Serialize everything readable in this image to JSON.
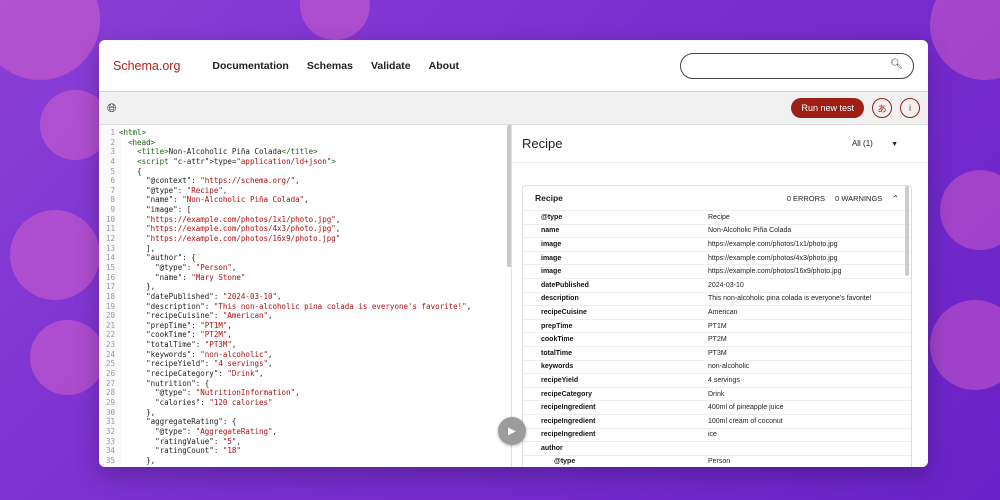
{
  "nav": {
    "brand": "Schema.org",
    "links": [
      "Documentation",
      "Schemas",
      "Validate",
      "About"
    ],
    "search_placeholder": ""
  },
  "toolbar": {
    "run_label": "Run new test",
    "translate_icon": "translate-icon",
    "info_icon": "info-icon",
    "globe_icon": "globe-icon"
  },
  "code_lines": [
    {
      "n": "1",
      "t": "<html>"
    },
    {
      "n": "2",
      "t": "  <head>"
    },
    {
      "n": "3",
      "t": "    <title>Non-Alcoholic Piña Colada</title>"
    },
    {
      "n": "4",
      "t": "    <script type=\"application/ld+json\">"
    },
    {
      "n": "5",
      "t": "    {"
    },
    {
      "n": "6",
      "t": "      \"@context\": \"https://schema.org/\","
    },
    {
      "n": "7",
      "t": "      \"@type\": \"Recipe\","
    },
    {
      "n": "8",
      "t": "      \"name\": \"Non-Alcoholic Piña Colada\","
    },
    {
      "n": "9",
      "t": "      \"image\": ["
    },
    {
      "n": "10",
      "t": "      \"https://example.com/photos/1x1/photo.jpg\","
    },
    {
      "n": "11",
      "t": "      \"https://example.com/photos/4x3/photo.jpg\","
    },
    {
      "n": "12",
      "t": "      \"https://example.com/photos/16x9/photo.jpg\""
    },
    {
      "n": "13",
      "t": "      ],"
    },
    {
      "n": "14",
      "t": "      \"author\": {"
    },
    {
      "n": "15",
      "t": "        \"@type\": \"Person\","
    },
    {
      "n": "16",
      "t": "        \"name\": \"Mary Stone\""
    },
    {
      "n": "17",
      "t": "      },"
    },
    {
      "n": "18",
      "t": "      \"datePublished\": \"2024-03-10\","
    },
    {
      "n": "19",
      "t": "      \"description\": \"This non-alcoholic pina colada is everyone's favorite!\","
    },
    {
      "n": "20",
      "t": "      \"recipeCuisine\": \"American\","
    },
    {
      "n": "21",
      "t": "      \"prepTime\": \"PT1M\","
    },
    {
      "n": "22",
      "t": "      \"cookTime\": \"PT2M\","
    },
    {
      "n": "23",
      "t": "      \"totalTime\": \"PT3M\","
    },
    {
      "n": "24",
      "t": "      \"keywords\": \"non-alcoholic\","
    },
    {
      "n": "25",
      "t": "      \"recipeYield\": \"4 servings\","
    },
    {
      "n": "26",
      "t": "      \"recipeCategory\": \"Drink\","
    },
    {
      "n": "27",
      "t": "      \"nutrition\": {"
    },
    {
      "n": "28",
      "t": "        \"@type\": \"NutritionInformation\","
    },
    {
      "n": "29",
      "t": "        \"calories\": \"120 calories\""
    },
    {
      "n": "30",
      "t": "      },"
    },
    {
      "n": "31",
      "t": "      \"aggregateRating\": {"
    },
    {
      "n": "32",
      "t": "        \"@type\": \"AggregateRating\","
    },
    {
      "n": "33",
      "t": "        \"ratingValue\": \"5\","
    },
    {
      "n": "34",
      "t": "        \"ratingCount\": \"18\""
    },
    {
      "n": "35",
      "t": "      },"
    }
  ],
  "results": {
    "title": "Recipe",
    "filter": "All (1)",
    "card_title": "Recipe",
    "errors": "0 ERRORS",
    "warnings": "0 WARNINGS",
    "rows": [
      {
        "k": "@type",
        "v": "Recipe",
        "sub": false
      },
      {
        "k": "name",
        "v": "Non-Alcoholic Piña Colada",
        "sub": false
      },
      {
        "k": "image",
        "v": "https://example.com/photos/1x1/photo.jpg",
        "sub": false
      },
      {
        "k": "image",
        "v": "https://example.com/photos/4x3/photo.jpg",
        "sub": false
      },
      {
        "k": "image",
        "v": "https://example.com/photos/16x9/photo.jpg",
        "sub": false
      },
      {
        "k": "datePublished",
        "v": "2024-03-10",
        "sub": false
      },
      {
        "k": "description",
        "v": "This non-alcoholic pina colada is everyone's favorite!",
        "sub": false
      },
      {
        "k": "recipeCuisine",
        "v": "American",
        "sub": false
      },
      {
        "k": "prepTime",
        "v": "PT1M",
        "sub": false
      },
      {
        "k": "cookTime",
        "v": "PT2M",
        "sub": false
      },
      {
        "k": "totalTime",
        "v": "PT3M",
        "sub": false
      },
      {
        "k": "keywords",
        "v": "non-alcoholic",
        "sub": false
      },
      {
        "k": "recipeYield",
        "v": "4 servings",
        "sub": false
      },
      {
        "k": "recipeCategory",
        "v": "Drink",
        "sub": false
      },
      {
        "k": "recipeIngredient",
        "v": "400ml of pineapple juice",
        "sub": false
      },
      {
        "k": "recipeIngredient",
        "v": "100ml cream of coconut",
        "sub": false
      },
      {
        "k": "recipeIngredient",
        "v": "ice",
        "sub": false
      },
      {
        "k": "author",
        "v": "",
        "sub": false
      },
      {
        "k": "@type",
        "v": "Person",
        "sub": true
      }
    ]
  },
  "colors": {
    "brand": "#b5231b",
    "run_button": "#9d1f16",
    "background": "#7a2fd0"
  }
}
